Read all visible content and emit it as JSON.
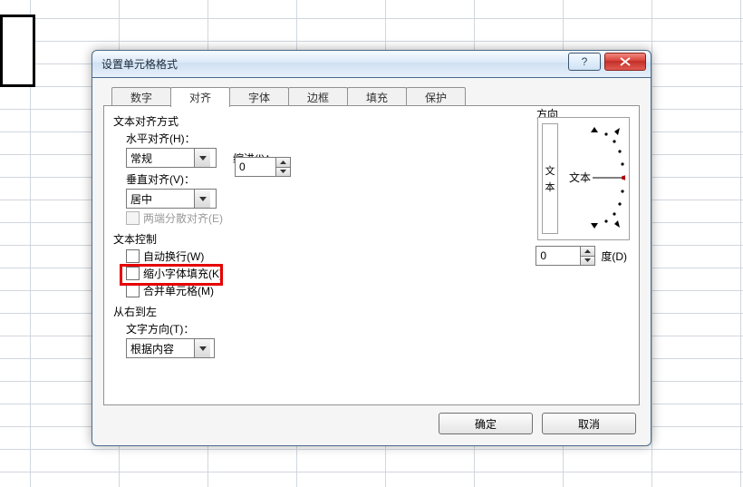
{
  "window": {
    "title": "设置单元格格式"
  },
  "tabs": [
    "数字",
    "对齐",
    "字体",
    "边框",
    "填充",
    "保护"
  ],
  "active_tab": "对齐",
  "align": {
    "section_title": "文本对齐方式",
    "h_label": "水平对齐(H)：",
    "h_value": "常规",
    "indent_label": "缩进(I)：",
    "indent_value": "0",
    "v_label": "垂直对齐(V)：",
    "v_value": "居中",
    "justify_distributed": "两端分散对齐(E)"
  },
  "text_control": {
    "section_title": "文本控制",
    "wrap": "自动换行(W)",
    "shrink": "缩小字体填充(K)",
    "merge": "合并单元格(M)"
  },
  "rtl": {
    "section_title": "从右到左",
    "dir_label": "文字方向(T)：",
    "dir_value": "根据内容"
  },
  "direction": {
    "section_title": "方向",
    "v_box_text": "文本",
    "h_text": "文本",
    "deg_value": "0",
    "deg_label": "度(D)"
  },
  "buttons": {
    "ok": "确定",
    "cancel": "取消"
  }
}
